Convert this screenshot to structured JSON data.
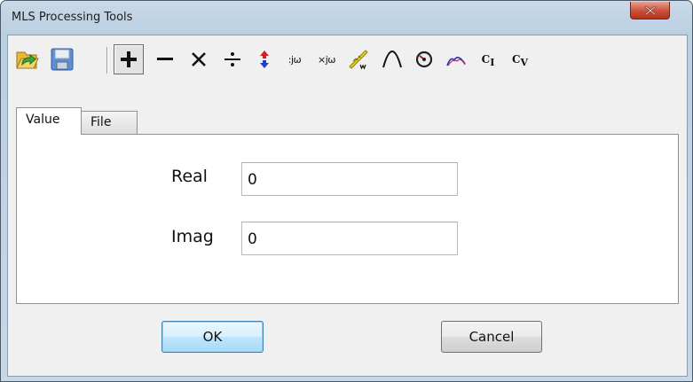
{
  "window": {
    "title": "MLS Processing Tools"
  },
  "toolbar": {
    "items": [
      {
        "name": "open-file-icon"
      },
      {
        "name": "save-icon"
      },
      {
        "name": "add-icon",
        "pressed": true
      },
      {
        "name": "subtract-icon"
      },
      {
        "name": "multiply-icon"
      },
      {
        "name": "divide-icon"
      },
      {
        "name": "swap-icon"
      },
      {
        "name": "divide-jw-icon",
        "text": ":jω"
      },
      {
        "name": "multiply-jw-icon",
        "text": "×jω"
      },
      {
        "name": "spl-w-icon"
      },
      {
        "name": "peak-curve-icon"
      },
      {
        "name": "dial-icon"
      },
      {
        "name": "smooth-curve-icon"
      },
      {
        "name": "ci-icon",
        "text": "C",
        "sub": "I"
      },
      {
        "name": "cv-icon",
        "text": "C",
        "sub": "V"
      }
    ]
  },
  "tabs": [
    {
      "label": "Value",
      "active": true
    },
    {
      "label": "File",
      "active": false
    }
  ],
  "fields": {
    "real": {
      "label": "Real",
      "value": "0"
    },
    "imag": {
      "label": "Imag",
      "value": "0"
    }
  },
  "buttons": {
    "ok": "OK",
    "cancel": "Cancel"
  },
  "colors": {
    "accent": "#3c7fb1",
    "close": "#c9503a"
  }
}
